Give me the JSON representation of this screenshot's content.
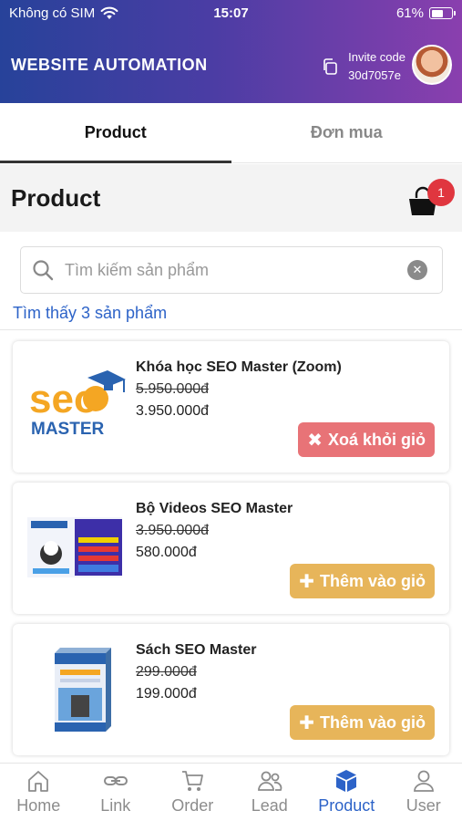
{
  "status_bar": {
    "carrier": "Không có SIM",
    "time": "15:07",
    "battery": "61%"
  },
  "header": {
    "title": "WEBSITE AUTOMATION",
    "invite_label": "Invite code",
    "invite_code": "30d7057e"
  },
  "tabs": [
    {
      "label": "Product",
      "active": true
    },
    {
      "label": "Đơn mua",
      "active": false
    }
  ],
  "page": {
    "title": "Product",
    "cart_count": "1"
  },
  "search": {
    "placeholder": "Tìm kiếm sản phẩm",
    "value": ""
  },
  "results_text": "Tìm thấy 3 sản phẩm",
  "products": [
    {
      "name": "Khóa học SEO Master (Zoom)",
      "old_price": "5.950.000đ",
      "price": "3.950.000đ",
      "action": "Xoá khỏi giỏ",
      "action_type": "remove"
    },
    {
      "name": "Bộ Videos SEO Master",
      "old_price": "3.950.000đ",
      "price": "580.000đ",
      "action": "Thêm vào giỏ",
      "action_type": "add"
    },
    {
      "name": "Sách SEO Master",
      "old_price": "299.000đ",
      "price": "199.000đ",
      "action": "Thêm vào giỏ",
      "action_type": "add"
    }
  ],
  "thumb_text": {
    "seo": "seo",
    "master": "MASTER"
  },
  "bottom_nav": [
    {
      "label": "Home",
      "icon": "home-icon",
      "active": false
    },
    {
      "label": "Link",
      "icon": "link-icon",
      "active": false
    },
    {
      "label": "Order",
      "icon": "cart-icon",
      "active": false
    },
    {
      "label": "Lead",
      "icon": "users-icon",
      "active": false
    },
    {
      "label": "Product",
      "icon": "cube-icon",
      "active": true
    },
    {
      "label": "User",
      "icon": "user-icon",
      "active": false
    }
  ],
  "colors": {
    "header_start": "#27429a",
    "header_end": "#8a3fae",
    "accent": "#2d63c8",
    "remove": "#e87377",
    "add": "#e7b55a",
    "badge": "#e0363f"
  }
}
